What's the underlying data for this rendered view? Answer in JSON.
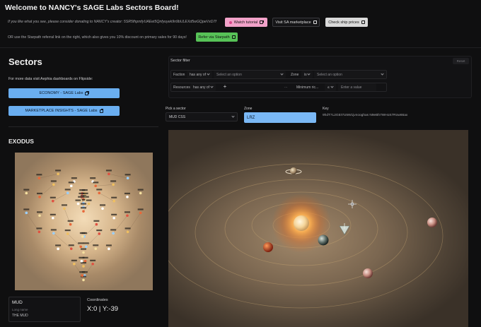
{
  "header": {
    "title": "Welcome to NANCY's SAGE Labs Sectors Board!",
    "donate_text": "If you like what you see, please consider donating to NANCY's creator: 5SR5fhpmfyUAEet5Qnfyuyek9n9bULEXd5wGQpeVxD7f",
    "referral_text": "OR use the Starpath referral link on the right, which also gives you 10% discount on primary sales for 90 days!",
    "watch_tutorial": "Watch tutorial",
    "sa_marketplace": "Visit SA marketplace",
    "ship_prices": "Check ship prices",
    "refer_starpath": "Refer via Starpath"
  },
  "sidebar": {
    "title": "Sectors",
    "info": "For more data visit Aephia dashboards on Flipside:",
    "economy_button": "ECONOMY - SAGE Labs",
    "marketplace_button": "MARKETPLACE INSIGHTS - SAGE Labs",
    "faction_title": "EXODUS"
  },
  "sector_info": {
    "name": "MUD",
    "long_name_label": "Long name",
    "long_name": "THE MUD",
    "coordinates_label": "Coordinates",
    "coordinates": "X:0 | Y:-39"
  },
  "filter": {
    "title": "Sector filter",
    "reset": "Reset",
    "faction_label": "Faction",
    "faction_op": "has any of",
    "faction_placeholder": "Select an option",
    "zone_label": "Zone",
    "zone_op": "is",
    "zone_placeholder": "Select an option",
    "resources_label": "Resources",
    "resources_op": "has any of",
    "add_symbol": "+",
    "ellipsis": "...",
    "min_richness_label": "Minimum ric...",
    "min_richness_op": "≤",
    "value_placeholder": "Enter a value"
  },
  "picker": {
    "sector_label": "Pick a sector",
    "sector_value": "MUD CSS",
    "zone_label": "Zone",
    "zone_value": "LRZ",
    "key_label": "Key",
    "key_value": "9hdT7L2GEt7U5W1jvnooghas N9eBh7WHoS7Row66ax"
  },
  "colors": {
    "background": "#0f0f10",
    "accent_blue": "#6aaef0",
    "pink": "#f2a2c9",
    "green": "#57c257",
    "zone_blue": "#7ab8f5"
  }
}
